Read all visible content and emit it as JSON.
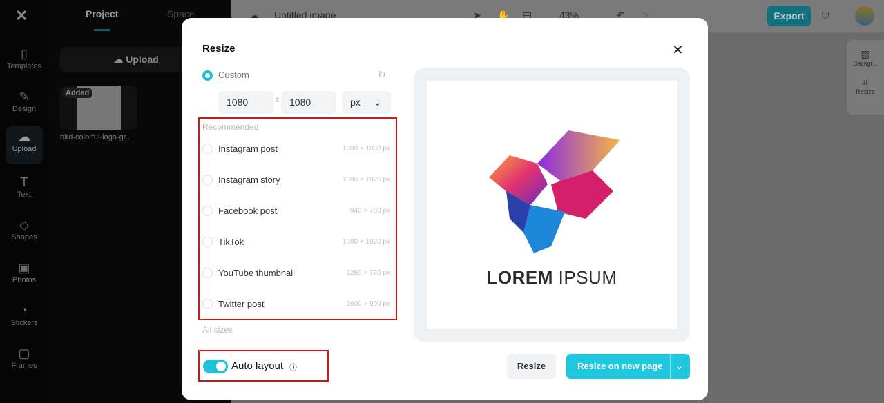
{
  "app": {
    "logo": "CapCut",
    "rail": [
      {
        "label": "Templates",
        "icon": "templates-icon"
      },
      {
        "label": "Design",
        "icon": "design-icon"
      },
      {
        "label": "Upload",
        "icon": "upload-icon",
        "active": true
      },
      {
        "label": "Text",
        "icon": "text-icon"
      },
      {
        "label": "Shapes",
        "icon": "shapes-icon"
      },
      {
        "label": "Photos",
        "icon": "photos-icon"
      },
      {
        "label": "Stickers",
        "icon": "stickers-icon"
      },
      {
        "label": "Frames",
        "icon": "frames-icon"
      }
    ]
  },
  "panel": {
    "tabs": [
      "Project",
      "Space"
    ],
    "upload_label": "Upload",
    "asset": {
      "badge": "Added",
      "name": "bird-colorful-logo-gr..."
    }
  },
  "topbar": {
    "doc_title": "Untitled image",
    "zoom": "43%",
    "export_label": "Export"
  },
  "right_tools": [
    "Backgr...",
    "Resize"
  ],
  "modal": {
    "title": "Resize",
    "custom_label": "Custom",
    "width": "1080",
    "height": "1080",
    "unit": "px",
    "recommended_label": "Recommended",
    "options": [
      {
        "name": "Instagram post",
        "size": "1080 × 1080 px"
      },
      {
        "name": "Instagram story",
        "size": "1080 × 1920 px"
      },
      {
        "name": "Facebook post",
        "size": "940 × 788 px"
      },
      {
        "name": "TikTok",
        "size": "1080 × 1920 px"
      },
      {
        "name": "YouTube thumbnail",
        "size": "1280 × 720 px"
      },
      {
        "name": "Twitter post",
        "size": "1600 × 900 px"
      }
    ],
    "all_sizes": "All sizes",
    "auto_layout": "Auto layout",
    "auto_layout_on": true,
    "resize_label": "Resize",
    "resize_new_label": "Resize on new page",
    "preview_logo": {
      "word1": "LOREM",
      "word2": "IPSUM"
    }
  },
  "colors": {
    "accent": "#1fc1d6",
    "highlight": "#d81414"
  }
}
